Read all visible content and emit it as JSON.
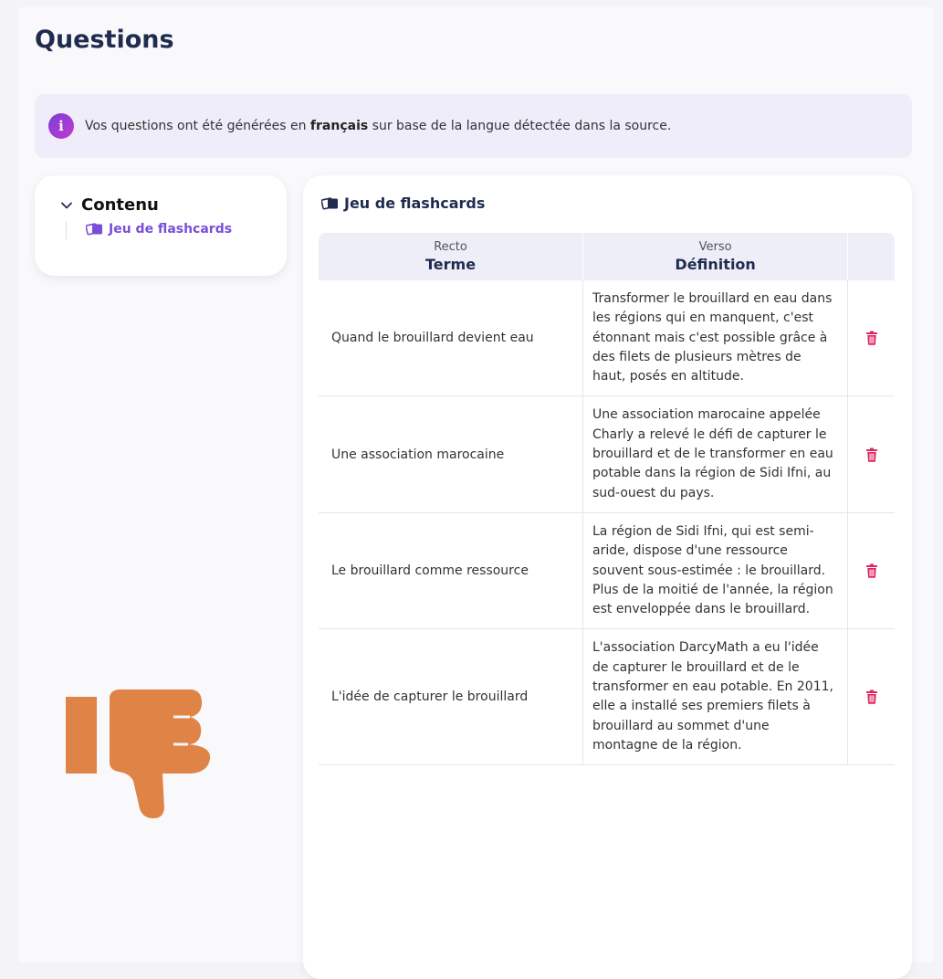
{
  "page": {
    "title": "Questions"
  },
  "banner": {
    "icon": "info-icon",
    "text_before": "Vos questions ont été générées en ",
    "text_bold": "français",
    "text_after": " sur base de la langue détectée dans la source."
  },
  "toc": {
    "title": "Contenu",
    "items": [
      {
        "label": "Jeu de flashcards",
        "icon": "cards-icon"
      }
    ]
  },
  "section": {
    "title": "Jeu de flashcards"
  },
  "table": {
    "col1_sub": "Recto",
    "col1_main": "Terme",
    "col2_sub": "Verso",
    "col2_main": "Définition",
    "rows": [
      {
        "term": "Quand le brouillard devient eau",
        "definition": "Transformer le brouillard en eau dans les régions qui en manquent, c'est étonnant mais c'est possible grâce à des filets de plusieurs mètres de haut, posés en altitude."
      },
      {
        "term": "Une association marocaine",
        "definition": "Une association marocaine appelée Charly a relevé le défi de capturer le brouillard et de le transformer en eau potable dans la région de Sidi Ifni, au sud-ouest du pays."
      },
      {
        "term": "Le brouillard comme ressource",
        "definition": "La région de Sidi Ifni, qui est semi-aride, dispose d'une ressource souvent sous-estimée : le brouillard. Plus de la moitié de l'année, la région est enveloppée dans le brouillard."
      },
      {
        "term": "L'idée de capturer le brouillard",
        "definition": "L'association DarcyMath a eu l'idée de capturer le brouillard et de le transformer en eau potable. En 2011, elle a installé ses premiers filets à brouillard au sommet d'une montagne de la région."
      }
    ]
  },
  "colors": {
    "accent": "#7a4ed9",
    "delete": "#e0245e",
    "thumb": "#e08347"
  }
}
